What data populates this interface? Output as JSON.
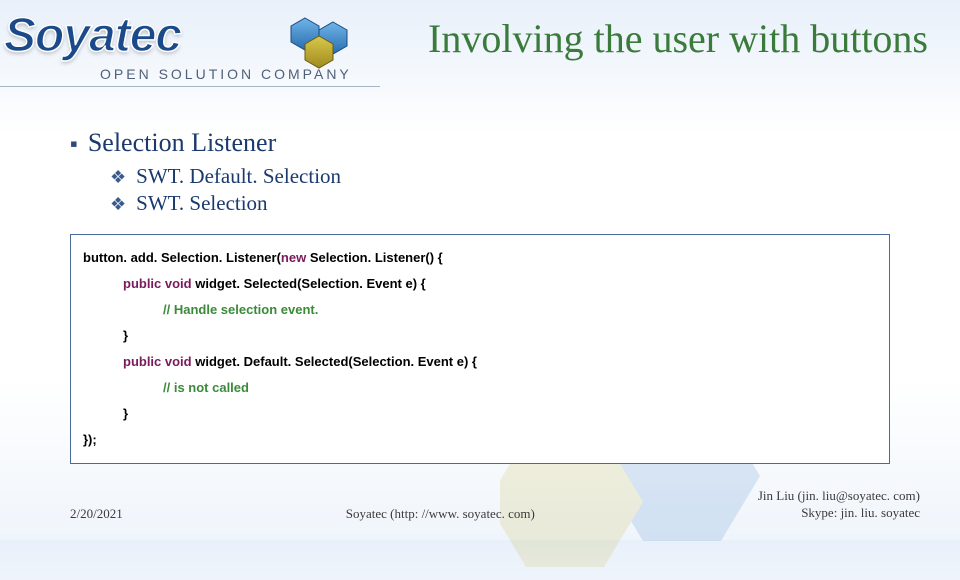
{
  "logo": {
    "brand": "Soyatec",
    "tagline": "Open Solution Company"
  },
  "title": "Involving the user with buttons",
  "bullets": {
    "l1": "Selection Listener",
    "l2a": "SWT. Default. Selection",
    "l2b": "SWT. Selection"
  },
  "code": {
    "line1a": "button. add. Selection. Listener(",
    "line1_new": "new",
    "line1b": " Selection. Listener() {",
    "line2_kw": "public void",
    "line2b": " widget. Selected(Selection. Event e) {",
    "line3_cm": "// Handle selection event.",
    "line4": "}",
    "line5_kw": "public void",
    "line5b": " widget. Default. Selected(Selection. Event e) {",
    "line6_cm": "// is not called",
    "line7": "}",
    "line8": "});"
  },
  "footer": {
    "date": "2/20/2021",
    "center": "Soyatec (http: //www. soyatec. com)",
    "r1": "Jin Liu (jin. liu@soyatec. com)",
    "r2": "Skype: jin. liu. soyatec"
  }
}
